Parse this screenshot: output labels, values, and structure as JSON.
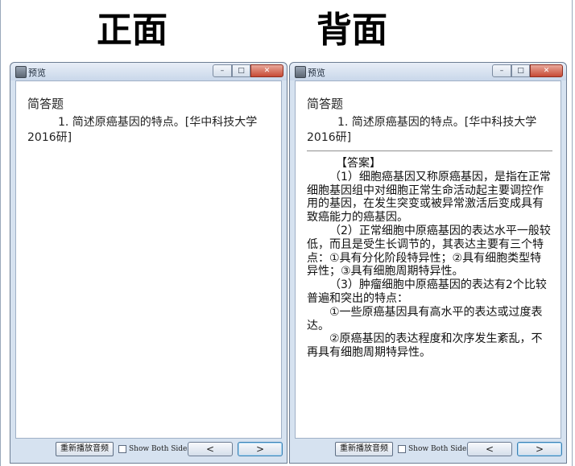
{
  "labels": {
    "front": "正面",
    "back": "背面"
  },
  "window": {
    "title": "预览",
    "controls": {
      "minimize": "–",
      "maximize": "□",
      "close": "✕"
    },
    "bottom": {
      "replay_label": "重新播放音频",
      "show_both_label": "Show Both Sides",
      "prev_label": "<",
      "next_label": ">"
    }
  },
  "card": {
    "section": "简答题",
    "question": "1. 简述原癌基因的特点。[华中科技大学2016研]",
    "answer": [
      "【答案】",
      "（1）细胞癌基因又称原癌基因，是指在正常细胞基因组中对细胞正常生命活动起主要调控作用的基因，在发生突变或被异常激活后变成具有致癌能力的癌基因。",
      "（2）正常细胞中原癌基因的表达水平一般较低，而且是受生长调节的，其表达主要有三个特点：①具有分化阶段特异性；②具有细胞类型特异性；③具有细胞周期特异性。",
      "（3）肿瘤细胞中原癌基因的表达有2个比较普遍和突出的特点：",
      "①一些原癌基因具有高水平的表达或过度表达。",
      "②原癌基因的表达程度和次序发生紊乱，不再具有细胞周期特异性。"
    ]
  }
}
